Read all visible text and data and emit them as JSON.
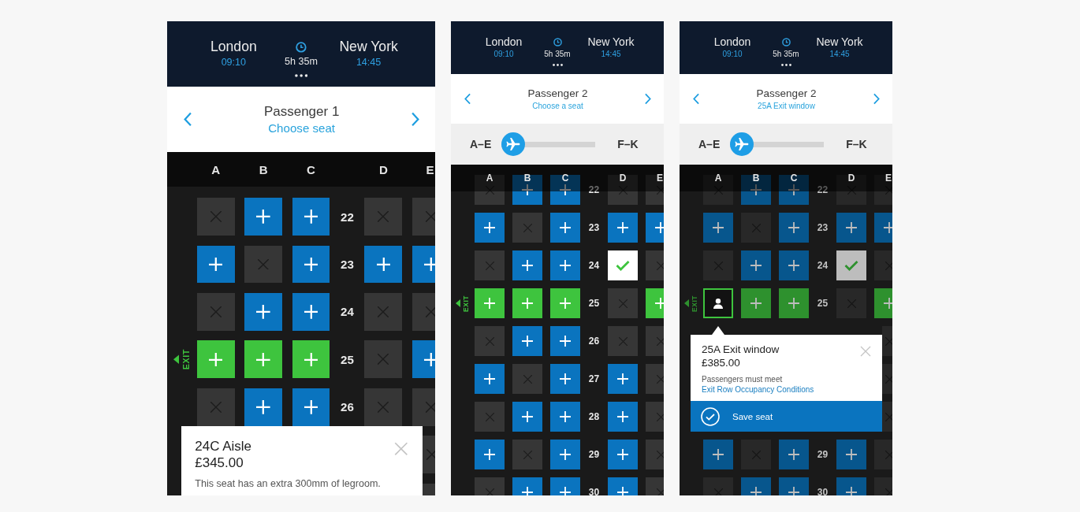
{
  "screens": [
    {
      "header": {
        "origin": "London",
        "departure": "09:10",
        "duration": "5h 35m",
        "destination": "New York",
        "arrival": "14:45"
      },
      "passenger": {
        "name": "Passenger 1",
        "status": "Choose seat"
      },
      "seat_map": {
        "scrolled": false,
        "dimmed": false,
        "columns": [
          "A",
          "B",
          "C",
          "D",
          "E"
        ],
        "items": [
          {
            "kind": "row",
            "number": "22",
            "seats": [
              {
                "kind": "occupied",
                "selected": false
              },
              {
                "kind": "available",
                "selected": false
              },
              {
                "kind": "available",
                "selected": false
              },
              {
                "kind": "occupied",
                "selected": false
              },
              {
                "kind": "occupied",
                "selected": false
              }
            ]
          },
          {
            "kind": "row",
            "number": "23",
            "seats": [
              {
                "kind": "available",
                "selected": false
              },
              {
                "kind": "occupied",
                "selected": false
              },
              {
                "kind": "available",
                "selected": false
              },
              {
                "kind": "available",
                "selected": false
              },
              {
                "kind": "available",
                "selected": false
              }
            ]
          },
          {
            "kind": "row",
            "number": "24",
            "seats": [
              {
                "kind": "occupied",
                "selected": false
              },
              {
                "kind": "available",
                "selected": false
              },
              {
                "kind": "available",
                "selected": false
              },
              {
                "kind": "occupied",
                "selected": false
              },
              {
                "kind": "occupied",
                "selected": false
              }
            ]
          },
          {
            "kind": "row",
            "number": "25",
            "exit_label": "EXIT",
            "seats": [
              {
                "kind": "exit",
                "selected": false
              },
              {
                "kind": "exit",
                "selected": false
              },
              {
                "kind": "exit",
                "selected": false
              },
              {
                "kind": "occupied",
                "selected": false
              },
              {
                "kind": "available",
                "selected": false
              }
            ]
          },
          {
            "kind": "row",
            "number": "26",
            "seats": [
              {
                "kind": "occupied",
                "selected": false
              },
              {
                "kind": "available",
                "selected": false
              },
              {
                "kind": "available",
                "selected": false
              },
              {
                "kind": "occupied",
                "selected": false
              },
              {
                "kind": "occupied",
                "selected": false
              }
            ]
          },
          {
            "kind": "sheet",
            "title": "24C Aisle",
            "price": "£345.00",
            "text": "This seat has an extra 300mm of legroom.",
            "edge_seats": [
              {
                "kind": "occupied",
                "selected": false
              },
              {
                "kind": "occupied",
                "selected": false
              }
            ]
          }
        ]
      }
    },
    {
      "header": {
        "origin": "London",
        "departure": "09:10",
        "duration": "5h 35m",
        "destination": "New York",
        "arrival": "14:45"
      },
      "passenger": {
        "name": "Passenger 2",
        "status": "Choose a seat"
      },
      "deck_slider": {
        "left_label": "A–E",
        "right_label": "F–K",
        "level": 0
      },
      "seat_map": {
        "scrolled": true,
        "dimmed": false,
        "columns": [
          "A",
          "B",
          "C",
          "D",
          "E"
        ],
        "items": [
          {
            "kind": "row",
            "number": "22",
            "seats": [
              {
                "kind": "occupied",
                "selected": false
              },
              {
                "kind": "available",
                "selected": false
              },
              {
                "kind": "available",
                "selected": false
              },
              {
                "kind": "occupied",
                "selected": false
              },
              {
                "kind": "occupied",
                "selected": false
              }
            ]
          },
          {
            "kind": "row",
            "number": "23",
            "seats": [
              {
                "kind": "available",
                "selected": false
              },
              {
                "kind": "occupied",
                "selected": false
              },
              {
                "kind": "available",
                "selected": false
              },
              {
                "kind": "available",
                "selected": false
              },
              {
                "kind": "available",
                "selected": false
              }
            ]
          },
          {
            "kind": "row",
            "number": "24",
            "seats": [
              {
                "kind": "occupied",
                "selected": false
              },
              {
                "kind": "available",
                "selected": false
              },
              {
                "kind": "available",
                "selected": false
              },
              {
                "kind": "assigned",
                "selected": false
              },
              {
                "kind": "occupied",
                "selected": false
              }
            ]
          },
          {
            "kind": "row",
            "number": "25",
            "exit_label": "EXIT",
            "seats": [
              {
                "kind": "exit",
                "selected": false
              },
              {
                "kind": "exit",
                "selected": false
              },
              {
                "kind": "exit",
                "selected": false
              },
              {
                "kind": "occupied",
                "selected": false
              },
              {
                "kind": "exit",
                "selected": false
              }
            ]
          },
          {
            "kind": "row",
            "number": "26",
            "seats": [
              {
                "kind": "occupied",
                "selected": false
              },
              {
                "kind": "available",
                "selected": false
              },
              {
                "kind": "available",
                "selected": false
              },
              {
                "kind": "occupied",
                "selected": false
              },
              {
                "kind": "occupied",
                "selected": false
              }
            ]
          },
          {
            "kind": "row",
            "number": "27",
            "seats": [
              {
                "kind": "available",
                "selected": false
              },
              {
                "kind": "occupied",
                "selected": false
              },
              {
                "kind": "available",
                "selected": false
              },
              {
                "kind": "available",
                "selected": false
              },
              {
                "kind": "occupied",
                "selected": false
              }
            ]
          },
          {
            "kind": "row",
            "number": "28",
            "seats": [
              {
                "kind": "occupied",
                "selected": false
              },
              {
                "kind": "available",
                "selected": false
              },
              {
                "kind": "available",
                "selected": false
              },
              {
                "kind": "available",
                "selected": false
              },
              {
                "kind": "occupied",
                "selected": false
              }
            ]
          },
          {
            "kind": "row",
            "number": "29",
            "seats": [
              {
                "kind": "available",
                "selected": false
              },
              {
                "kind": "occupied",
                "selected": false
              },
              {
                "kind": "available",
                "selected": false
              },
              {
                "kind": "available",
                "selected": false
              },
              {
                "kind": "occupied",
                "selected": false
              }
            ]
          },
          {
            "kind": "row",
            "number": "30",
            "seats": [
              {
                "kind": "occupied",
                "selected": false
              },
              {
                "kind": "available",
                "selected": false
              },
              {
                "kind": "available",
                "selected": false
              },
              {
                "kind": "available",
                "selected": false
              },
              {
                "kind": "occupied",
                "selected": false
              }
            ]
          }
        ]
      }
    },
    {
      "header": {
        "origin": "London",
        "departure": "09:10",
        "duration": "5h 35m",
        "destination": "New York",
        "arrival": "14:45"
      },
      "passenger": {
        "name": "Passenger 2",
        "status": "25A Exit window"
      },
      "deck_slider": {
        "left_label": "A–E",
        "right_label": "F–K",
        "level": 0
      },
      "seat_map": {
        "scrolled": true,
        "dimmed": true,
        "columns": [
          "A",
          "B",
          "C",
          "D",
          "E"
        ],
        "items": [
          {
            "kind": "row",
            "number": "22",
            "seats": [
              {
                "kind": "occupied",
                "selected": false
              },
              {
                "kind": "available",
                "selected": false
              },
              {
                "kind": "available",
                "selected": false
              },
              {
                "kind": "occupied",
                "selected": false
              },
              {
                "kind": "occupied",
                "selected": false
              }
            ]
          },
          {
            "kind": "row",
            "number": "23",
            "seats": [
              {
                "kind": "available",
                "selected": false
              },
              {
                "kind": "occupied",
                "selected": false
              },
              {
                "kind": "available",
                "selected": false
              },
              {
                "kind": "available",
                "selected": false
              },
              {
                "kind": "available",
                "selected": false
              }
            ]
          },
          {
            "kind": "row",
            "number": "24",
            "seats": [
              {
                "kind": "occupied",
                "selected": false
              },
              {
                "kind": "available",
                "selected": false
              },
              {
                "kind": "available",
                "selected": false
              },
              {
                "kind": "assigned",
                "selected": false
              },
              {
                "kind": "occupied",
                "selected": false
              }
            ]
          },
          {
            "kind": "row",
            "number": "25",
            "exit_label": "EXIT",
            "seats": [
              {
                "kind": "exit",
                "selected": true
              },
              {
                "kind": "exit",
                "selected": false
              },
              {
                "kind": "exit",
                "selected": false
              },
              {
                "kind": "occupied",
                "selected": false
              },
              {
                "kind": "exit",
                "selected": false
              }
            ]
          },
          {
            "kind": "callout",
            "title": "25A Exit window",
            "price": "£385.00",
            "text": "Passengers must meet",
            "link": "Exit Row Occupancy Conditions",
            "button": "Save seat",
            "edge_seats": [
              {
                "kind": "occupied",
                "selected": false
              },
              {
                "kind": "occupied",
                "selected": false
              },
              {
                "kind": "occupied",
                "selected": false
              }
            ]
          },
          {
            "kind": "row",
            "number": "29",
            "seats": [
              {
                "kind": "available",
                "selected": false
              },
              {
                "kind": "occupied",
                "selected": false
              },
              {
                "kind": "available",
                "selected": false
              },
              {
                "kind": "available",
                "selected": false
              },
              {
                "kind": "occupied",
                "selected": false
              }
            ]
          },
          {
            "kind": "row",
            "number": "30",
            "seats": [
              {
                "kind": "occupied",
                "selected": false
              },
              {
                "kind": "available",
                "selected": false
              },
              {
                "kind": "available",
                "selected": false
              },
              {
                "kind": "available",
                "selected": false
              },
              {
                "kind": "occupied",
                "selected": false
              }
            ]
          }
        ]
      }
    }
  ]
}
